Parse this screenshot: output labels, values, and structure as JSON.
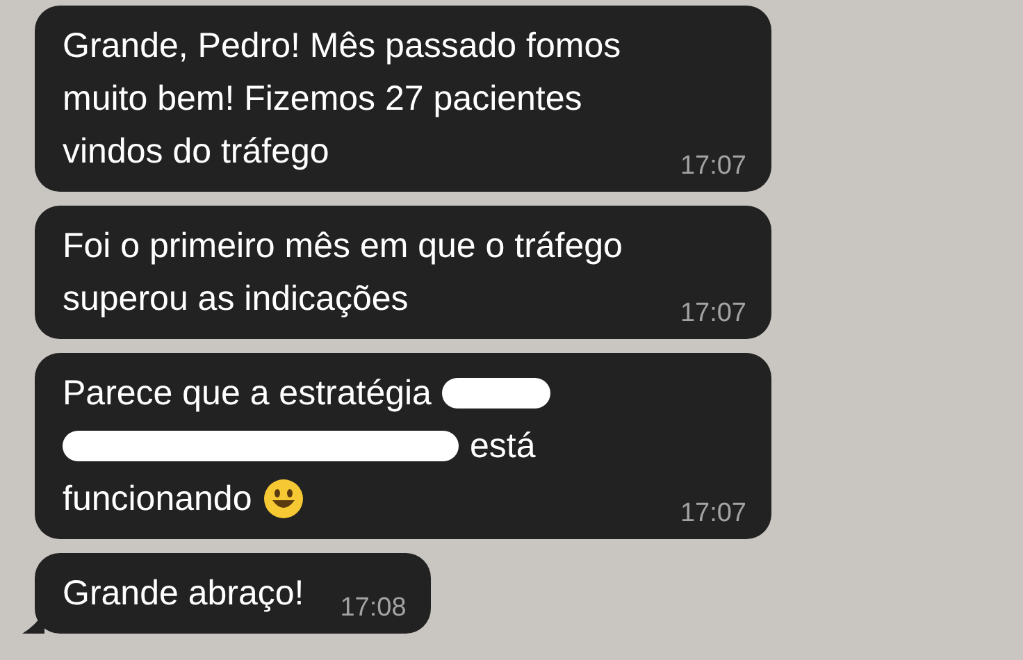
{
  "messages": [
    {
      "lines": [
        [
          {
            "kind": "text",
            "text": "Grande, Pedro! Mês passado fomos"
          }
        ],
        [
          {
            "kind": "text",
            "text": "muito bem! Fizemos 27 pacientes"
          }
        ],
        [
          {
            "kind": "text",
            "text": "vindos do tráfego"
          }
        ]
      ],
      "time": "17:07",
      "tail": false
    },
    {
      "lines": [
        [
          {
            "kind": "text",
            "text": "Foi o primeiro mês em que o tráfego"
          }
        ],
        [
          {
            "kind": "text",
            "text": "superou as indicações"
          }
        ]
      ],
      "time": "17:07",
      "tail": false
    },
    {
      "lines": [
        [
          {
            "kind": "text",
            "text": "Parece que a estratégia"
          },
          {
            "kind": "redaction"
          }
        ],
        [
          {
            "kind": "redaction"
          },
          {
            "kind": "text",
            "text": "está"
          }
        ],
        [
          {
            "kind": "text",
            "text": "funcionando"
          },
          {
            "kind": "emoji"
          }
        ]
      ],
      "time": "17:07",
      "tail": false
    },
    {
      "lines": [
        [
          {
            "kind": "text",
            "text": "Grande abraço!"
          }
        ]
      ],
      "time": "17:08",
      "tail": true
    }
  ]
}
